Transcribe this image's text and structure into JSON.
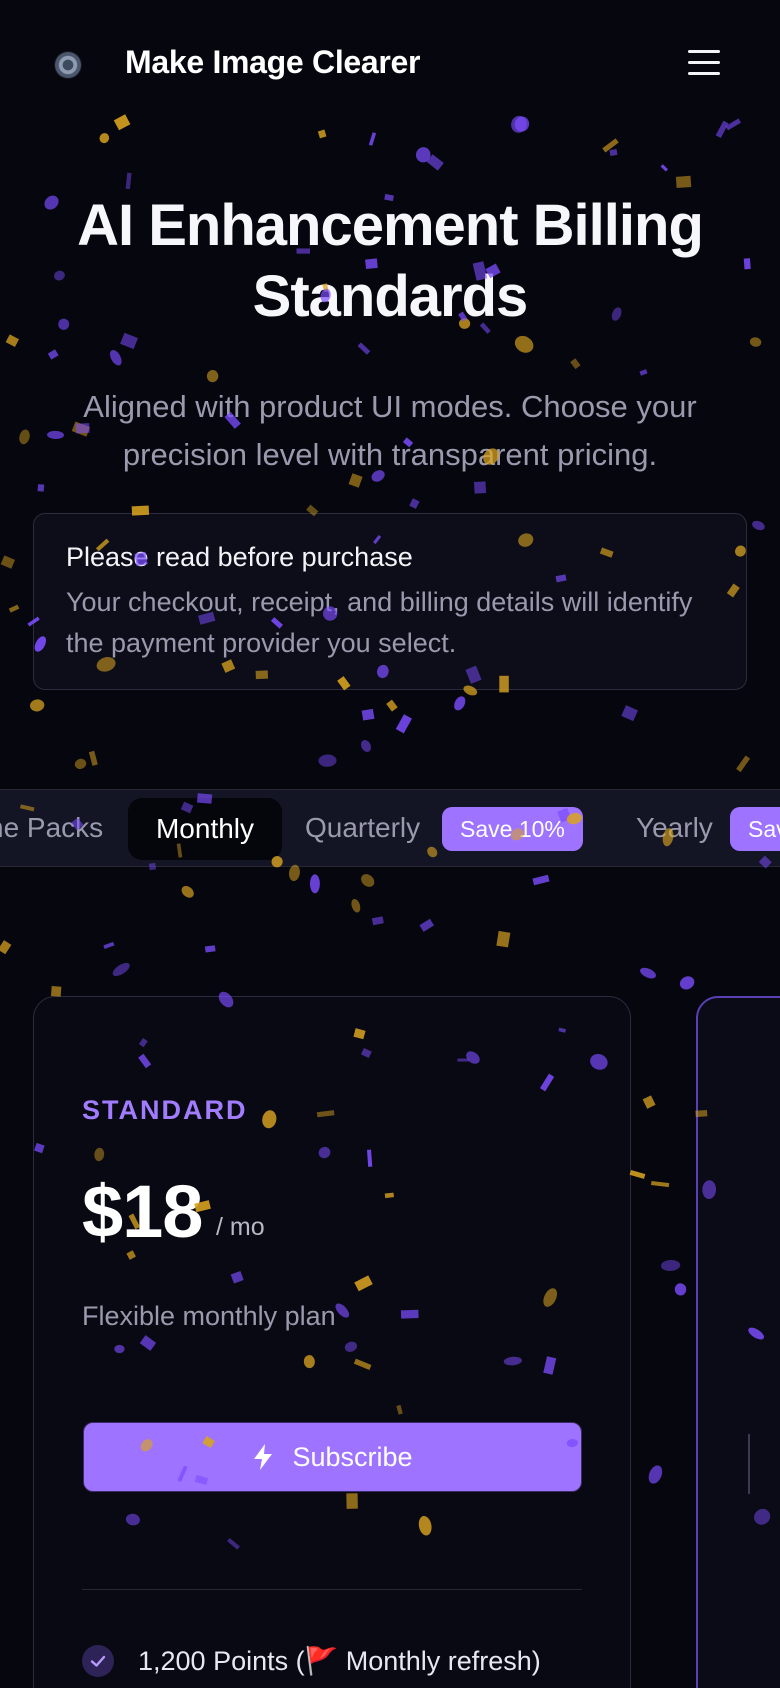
{
  "header": {
    "brand": "Make Image Clearer",
    "menu_icon": "hamburger-menu-icon"
  },
  "hero": {
    "title": "AI Enhancement Billing Standards",
    "subtitle": "Aligned with product UI modes. Choose your precision level with transparent pricing."
  },
  "notice": {
    "title": "Please read before purchase",
    "text": "Your checkout, receipt, and billing details will identify the payment provider you select."
  },
  "billing_tabs": {
    "items": [
      {
        "label": "ne Packs",
        "active": false
      },
      {
        "label": "Monthly",
        "active": true
      },
      {
        "label": "Quarterly",
        "active": false,
        "badge": "Save 10%"
      },
      {
        "label": "Yearly",
        "active": false,
        "badge": "Sav"
      }
    ]
  },
  "plans": [
    {
      "tier": "STANDARD",
      "price": "$18",
      "period": "/ mo",
      "description": "Flexible monthly plan",
      "cta": "Subscribe",
      "cta_icon": "lightning-bolt-icon",
      "features": [
        {
          "text": "1,200 Points (🚩 Monthly refresh)",
          "icon": "check-icon"
        }
      ]
    }
  ],
  "colors": {
    "background": "#06060f",
    "accent": "#9e73ff",
    "confetti_purple": "#7c4dff",
    "confetti_gold": "#d9a320"
  }
}
